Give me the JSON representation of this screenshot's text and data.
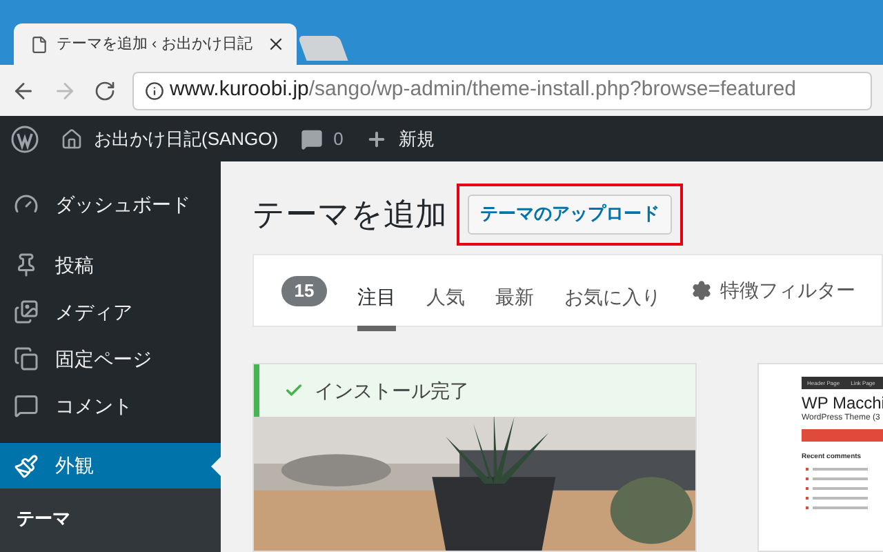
{
  "browser": {
    "tab_title": "テーマを追加 ‹ お出かけ日記",
    "url_host": "www.kuroobi.jp",
    "url_path": "/sango/wp-admin/theme-install.php?browse=featured"
  },
  "admin_bar": {
    "site": "お出かけ日記(SANGO)",
    "comments": "0",
    "new": "新規"
  },
  "sidebar": {
    "items": [
      {
        "label": "ダッシュボード",
        "selected": false
      },
      {
        "label": "投稿",
        "selected": false
      },
      {
        "label": "メディア",
        "selected": false
      },
      {
        "label": "固定ページ",
        "selected": false
      },
      {
        "label": "コメント",
        "selected": false
      },
      {
        "label": "外観",
        "selected": true
      }
    ],
    "submenu": [
      {
        "label": "テーマ",
        "selected": true
      }
    ]
  },
  "page": {
    "title": "テーマを追加",
    "upload_button": "テーマのアップロード",
    "highlighted": true
  },
  "filter_bar": {
    "count": "15",
    "tabs": [
      {
        "label": "注目",
        "selected": true
      },
      {
        "label": "人気",
        "selected": false
      },
      {
        "label": "最新",
        "selected": false
      },
      {
        "label": "お気に入り",
        "selected": false
      }
    ],
    "feature_filter": "特徴フィルター"
  },
  "themes": [
    {
      "notice": "インストール完了"
    },
    {
      "kind": "blog",
      "menu": [
        "Header Page",
        "Link Page"
      ],
      "site_title": "WP Macchi",
      "tagline": "WordPress Theme (3",
      "widget_title": "Recent comments"
    }
  ]
}
